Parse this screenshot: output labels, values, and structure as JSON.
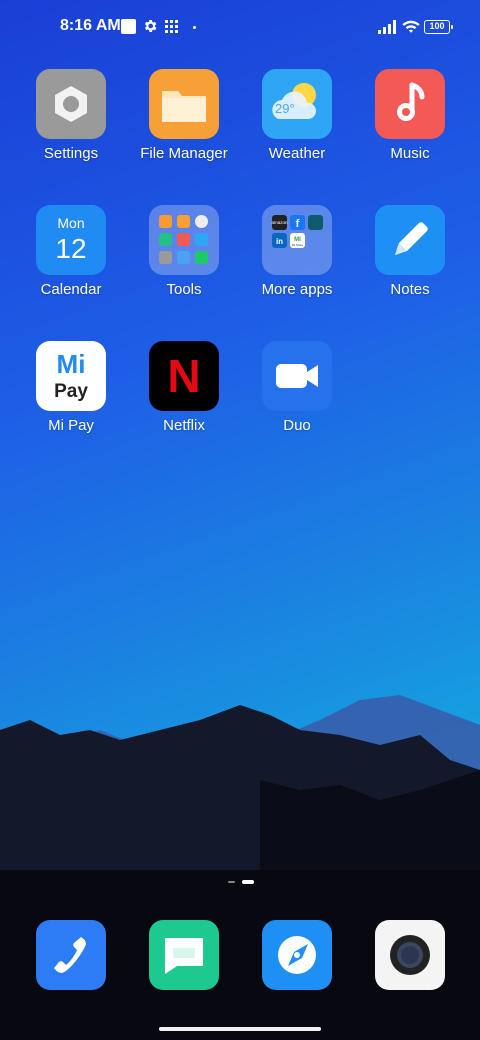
{
  "status_bar": {
    "time": "8:16 AM",
    "battery": "100",
    "icons": [
      "square-notification-icon",
      "gear-icon",
      "grid-icon",
      "dot-icon",
      "signal-icon",
      "wifi-icon",
      "battery-icon"
    ]
  },
  "apps": [
    {
      "label": "Settings",
      "icon": "settings-icon"
    },
    {
      "label": "File Manager",
      "icon": "folder-icon"
    },
    {
      "label": "Weather",
      "icon": "weather-icon",
      "temp": "29°"
    },
    {
      "label": "Music",
      "icon": "music-note-icon"
    },
    {
      "label": "Calendar",
      "icon": "calendar-icon",
      "day": "Mon",
      "date": "12"
    },
    {
      "label": "Tools",
      "icon": "tools-folder-icon"
    },
    {
      "label": "More apps",
      "icon": "more-apps-folder-icon",
      "mini_labels": [
        "amazon",
        "f",
        "in",
        "MI",
        "Mi Store"
      ]
    },
    {
      "label": "Notes",
      "icon": "pencil-icon"
    },
    {
      "label": "Mi Pay",
      "icon": "mi-pay-icon",
      "logo_top": "Mi",
      "logo_bottom": "Pay"
    },
    {
      "label": "Netflix",
      "icon": "netflix-icon",
      "logo": "N"
    },
    {
      "label": "Duo",
      "icon": "video-camera-icon"
    }
  ],
  "dock": [
    {
      "name": "phone",
      "icon": "phone-icon"
    },
    {
      "name": "messages",
      "icon": "message-icon"
    },
    {
      "name": "browser",
      "icon": "compass-icon"
    },
    {
      "name": "camera",
      "icon": "camera-icon"
    }
  ],
  "colors": {
    "settings_bg": "#9a9a9a",
    "files_bg": "#f7a035",
    "weather_bg": "#2ea6f5",
    "music_bg": "#f45a55",
    "calendar_bg": "#1f8bf3",
    "notes_bg": "#1e90f5",
    "mipay_bg": "#ffffff",
    "netflix_bg": "#000000",
    "duo_bg": "#2672ec",
    "phone_bg": "#2e7cf5",
    "messages_bg": "#1ec98f",
    "browser_bg": "#1e90f5",
    "camera_bg": "#f4f4f4"
  }
}
